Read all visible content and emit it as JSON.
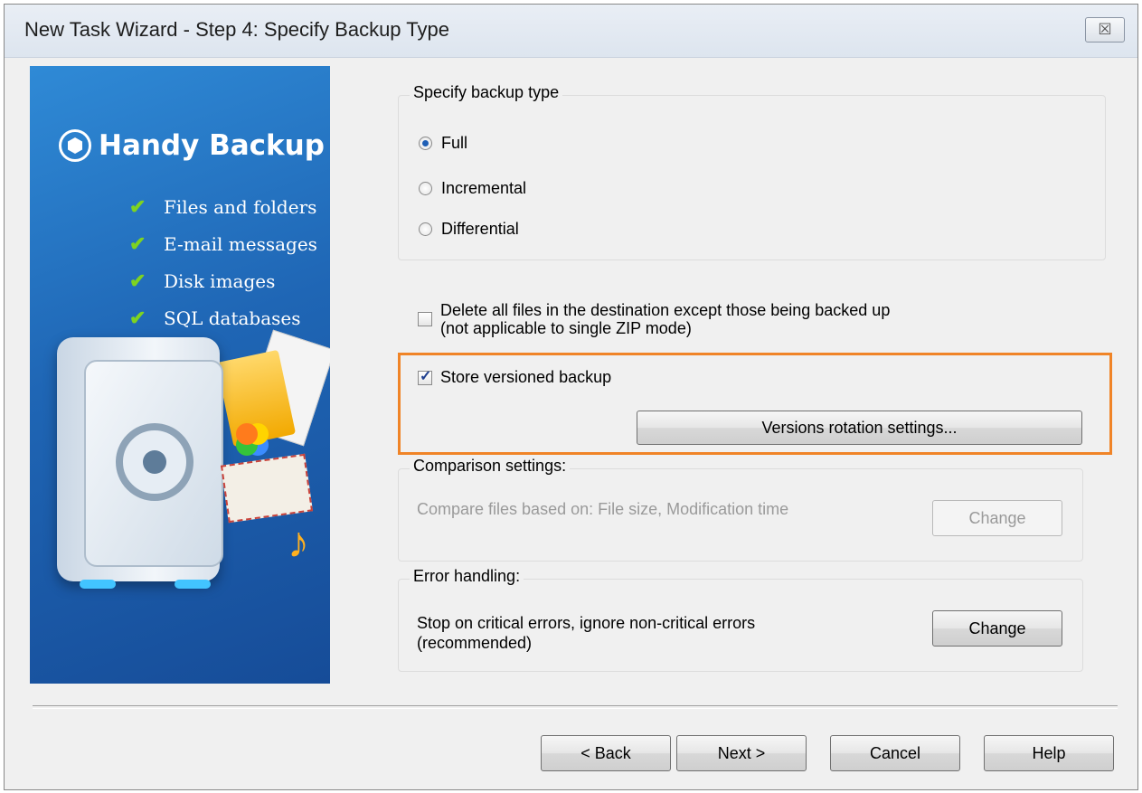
{
  "window": {
    "title": "New Task Wizard - Step 4: Specify Backup Type",
    "close_glyph": "☒"
  },
  "banner": {
    "brand": "Handy Backup",
    "features": [
      "Files and folders",
      "E-mail messages",
      "Disk images",
      "SQL databases"
    ],
    "check_glyph": "✔"
  },
  "backup_type": {
    "legend": "Specify backup type",
    "options": [
      "Full",
      "Incremental",
      "Differential"
    ],
    "selected": "Full"
  },
  "options": {
    "delete_files_label": "Delete all files in the destination except those being backed up",
    "delete_files_note": "(not applicable to single ZIP mode)",
    "delete_files_checked": false,
    "store_versioned_label": "Store versioned backup",
    "store_versioned_checked": true,
    "rotation_button": "Versions rotation settings..."
  },
  "comparison": {
    "legend": "Comparison settings:",
    "text": "Compare files based on: File size, Modification time",
    "change_button": "Change"
  },
  "error_handling": {
    "legend": "Error handling:",
    "text_line1": "Stop on critical errors, ignore non-critical errors",
    "text_line2": "(recommended)",
    "change_button": "Change"
  },
  "footer": {
    "back": "< Back",
    "next": "Next >",
    "cancel": "Cancel",
    "help": "Help"
  },
  "colors": {
    "highlight": "#f08427",
    "banner": "#1f66b5",
    "check": "#7ed321"
  }
}
